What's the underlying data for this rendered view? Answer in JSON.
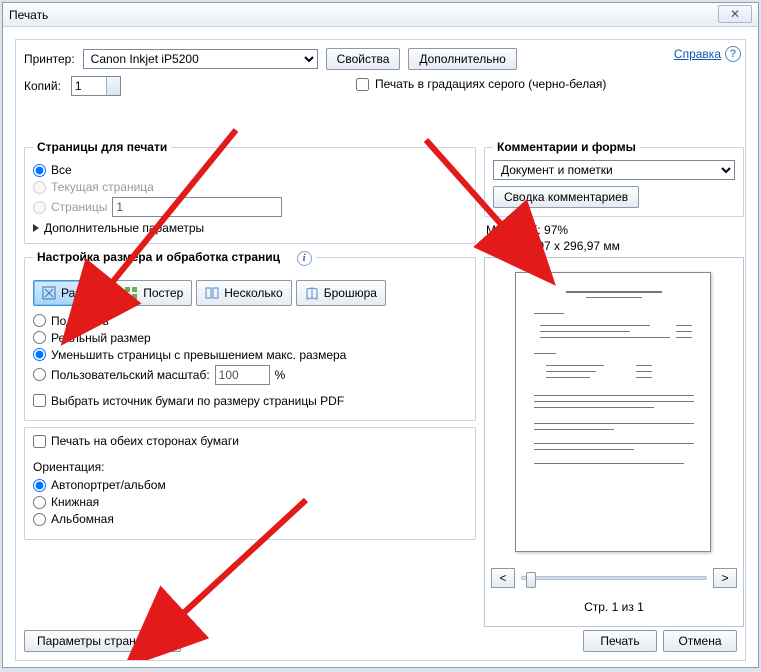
{
  "window": {
    "title": "Печать",
    "close_glyph": "✕"
  },
  "top": {
    "printer_label": "Принтер:",
    "printer_value": "Canon Inkjet iP5200",
    "properties_btn": "Свойства",
    "advanced_btn": "Дополнительно",
    "copies_label": "Копий:",
    "copies_value": "1",
    "grayscale_label": "Печать в градациях серого (черно-белая)",
    "help_link": "Справка",
    "help_glyph": "?"
  },
  "pages": {
    "legend": "Страницы для печати",
    "all": "Все",
    "current": "Текущая страница",
    "range_label": "Страницы",
    "range_value": "1",
    "more": "Дополнительные параметры"
  },
  "sizing": {
    "legend": "Настройка размера и обработка страниц",
    "info_glyph": "i",
    "tab_size": "Размер",
    "tab_poster": "Постер",
    "tab_multi": "Несколько",
    "tab_booklet": "Брошюра",
    "fit": "Подогнать",
    "actual": "Реальный размер",
    "shrink": "Уменьшить страницы с превышением макс. размера",
    "custom": "Пользовательский масштаб:",
    "custom_value": "100",
    "custom_unit": "%",
    "paper_by_pdf": "Выбрать источник бумаги по размеру страницы PDF"
  },
  "duplex": {
    "both_sides": "Печать на обеих сторонах бумаги",
    "orient_label": "Ориентация:",
    "auto": "Автопортрет/альбом",
    "portrait": "Книжная",
    "landscape": "Альбомная"
  },
  "comments": {
    "legend": "Комментарии и формы",
    "select_value": "Документ и пометки",
    "summary_btn": "Сводка комментариев"
  },
  "preview": {
    "scale_label": "Масштаб:",
    "scale_value": "97%",
    "paper_size": "209,97 x 296,97 мм",
    "prev_glyph": "<",
    "next_glyph": ">",
    "page_of": "Стр. 1 из 1"
  },
  "footer": {
    "page_setup": "Параметры страницы...",
    "print": "Печать",
    "cancel": "Отмена"
  }
}
